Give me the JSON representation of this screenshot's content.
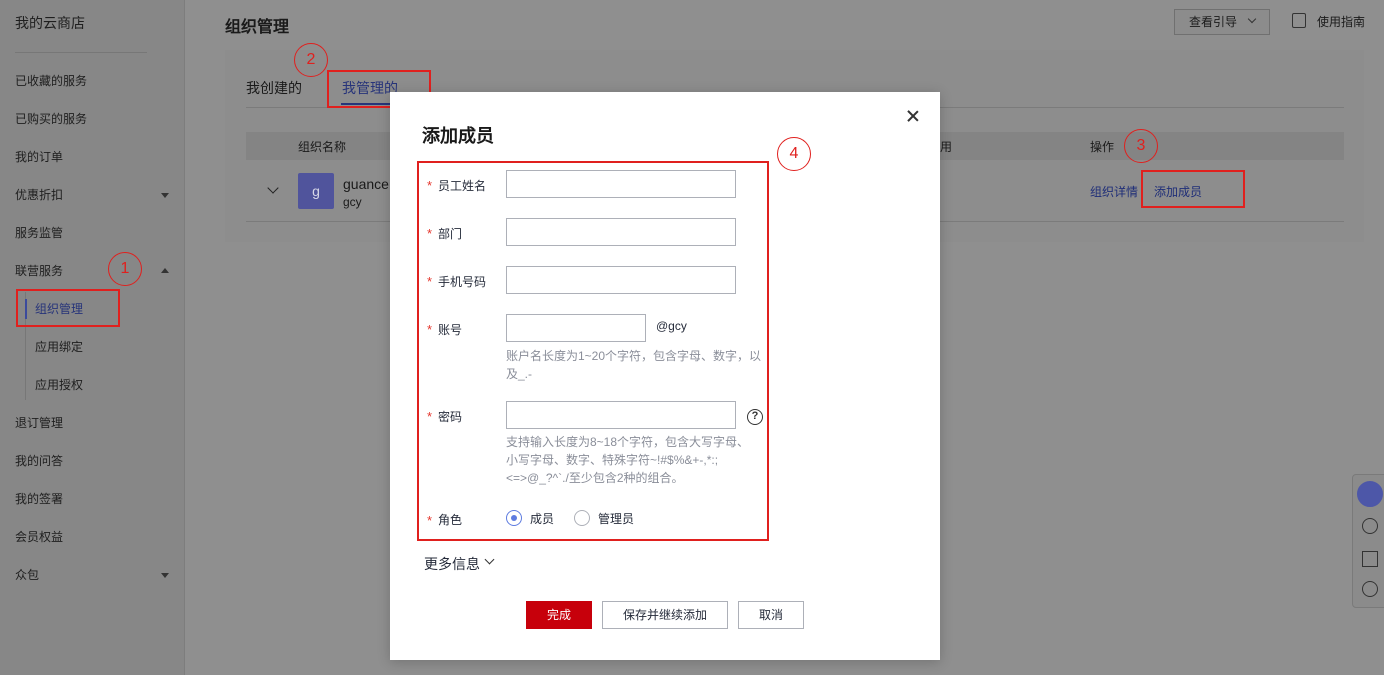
{
  "sidebar": {
    "title": "我的云商店",
    "items": [
      {
        "label": "已收藏的服务"
      },
      {
        "label": "已购买的服务"
      },
      {
        "label": "我的订单"
      },
      {
        "label": "优惠折扣"
      },
      {
        "label": "服务监管"
      },
      {
        "label": "联营服务"
      },
      {
        "label": "退订管理"
      },
      {
        "label": "我的问答"
      },
      {
        "label": "我的签署"
      },
      {
        "label": "会员权益"
      },
      {
        "label": "众包"
      }
    ],
    "sub_items": [
      {
        "label": "组织管理",
        "active": true
      },
      {
        "label": "应用绑定"
      },
      {
        "label": "应用授权"
      }
    ]
  },
  "header": {
    "title": "组织管理",
    "guide_button": "查看引导",
    "manual_link": "使用指南"
  },
  "tabs": [
    {
      "label": "我创建的"
    },
    {
      "label": "我管理的",
      "active": true
    }
  ],
  "table": {
    "headers": [
      "组织名称",
      "用",
      "操作"
    ],
    "rows": [
      {
        "avatar": "g",
        "name": "guance",
        "code": "gcy",
        "actions": [
          "组织详情",
          "添加成员"
        ]
      }
    ]
  },
  "annotations": [
    "1",
    "2",
    "3",
    "4"
  ],
  "modal": {
    "title": "添加成员",
    "required_mark": "*",
    "fields": {
      "name": {
        "label": "员工姓名",
        "value": ""
      },
      "department": {
        "label": "部门",
        "value": ""
      },
      "phone": {
        "label": "手机号码",
        "value": ""
      },
      "account": {
        "label": "账号",
        "value": "",
        "suffix": "@gcy",
        "hint": "账户名长度为1~20个字符，包含字母、数字，以及_.-"
      },
      "password": {
        "label": "密码",
        "value": "",
        "hint": "支持输入长度为8~18个字符，包含大写字母、小写字母、数字、特殊字符~!#$%&+-,*:;<=>@_?^`./至少包含2种的组合。"
      },
      "role": {
        "label": "角色",
        "options": [
          "成员",
          "管理员"
        ],
        "selected": "成员"
      }
    },
    "more_info": "更多信息",
    "buttons": {
      "done": "完成",
      "save_continue": "保存并继续添加",
      "cancel": "取消"
    }
  },
  "colors": {
    "primary_button": "#c7000b",
    "annotation_red": "#e0201e",
    "link": "#1f2e78",
    "radio_accent": "#5e7ce0"
  }
}
